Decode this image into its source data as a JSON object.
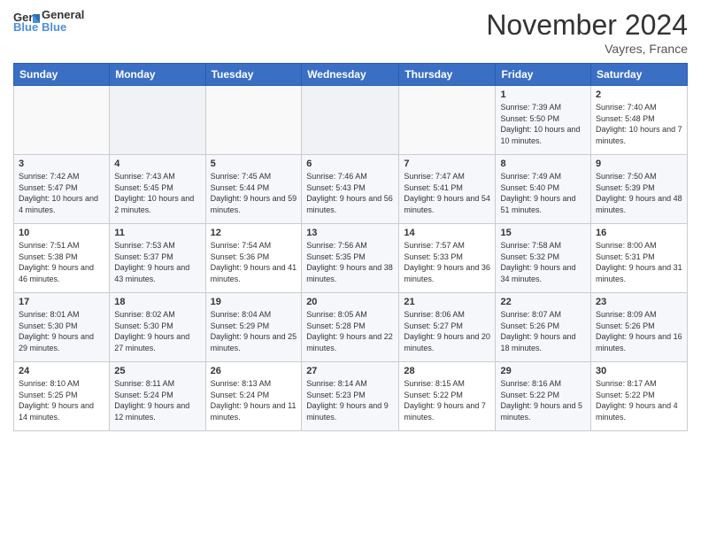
{
  "header": {
    "logo_text_general": "General",
    "logo_text_blue": "Blue",
    "month_title": "November 2024",
    "location": "Vayres, France"
  },
  "weekdays": [
    "Sunday",
    "Monday",
    "Tuesday",
    "Wednesday",
    "Thursday",
    "Friday",
    "Saturday"
  ],
  "weeks": [
    [
      {
        "day": "",
        "empty": true
      },
      {
        "day": "",
        "empty": true
      },
      {
        "day": "",
        "empty": true
      },
      {
        "day": "",
        "empty": true
      },
      {
        "day": "",
        "empty": true
      },
      {
        "day": "1",
        "sunrise": "Sunrise: 7:39 AM",
        "sunset": "Sunset: 5:50 PM",
        "daylight": "Daylight: 10 hours and 10 minutes."
      },
      {
        "day": "2",
        "sunrise": "Sunrise: 7:40 AM",
        "sunset": "Sunset: 5:48 PM",
        "daylight": "Daylight: 10 hours and 7 minutes."
      }
    ],
    [
      {
        "day": "3",
        "sunrise": "Sunrise: 7:42 AM",
        "sunset": "Sunset: 5:47 PM",
        "daylight": "Daylight: 10 hours and 4 minutes."
      },
      {
        "day": "4",
        "sunrise": "Sunrise: 7:43 AM",
        "sunset": "Sunset: 5:45 PM",
        "daylight": "Daylight: 10 hours and 2 minutes."
      },
      {
        "day": "5",
        "sunrise": "Sunrise: 7:45 AM",
        "sunset": "Sunset: 5:44 PM",
        "daylight": "Daylight: 9 hours and 59 minutes."
      },
      {
        "day": "6",
        "sunrise": "Sunrise: 7:46 AM",
        "sunset": "Sunset: 5:43 PM",
        "daylight": "Daylight: 9 hours and 56 minutes."
      },
      {
        "day": "7",
        "sunrise": "Sunrise: 7:47 AM",
        "sunset": "Sunset: 5:41 PM",
        "daylight": "Daylight: 9 hours and 54 minutes."
      },
      {
        "day": "8",
        "sunrise": "Sunrise: 7:49 AM",
        "sunset": "Sunset: 5:40 PM",
        "daylight": "Daylight: 9 hours and 51 minutes."
      },
      {
        "day": "9",
        "sunrise": "Sunrise: 7:50 AM",
        "sunset": "Sunset: 5:39 PM",
        "daylight": "Daylight: 9 hours and 48 minutes."
      }
    ],
    [
      {
        "day": "10",
        "sunrise": "Sunrise: 7:51 AM",
        "sunset": "Sunset: 5:38 PM",
        "daylight": "Daylight: 9 hours and 46 minutes."
      },
      {
        "day": "11",
        "sunrise": "Sunrise: 7:53 AM",
        "sunset": "Sunset: 5:37 PM",
        "daylight": "Daylight: 9 hours and 43 minutes."
      },
      {
        "day": "12",
        "sunrise": "Sunrise: 7:54 AM",
        "sunset": "Sunset: 5:36 PM",
        "daylight": "Daylight: 9 hours and 41 minutes."
      },
      {
        "day": "13",
        "sunrise": "Sunrise: 7:56 AM",
        "sunset": "Sunset: 5:35 PM",
        "daylight": "Daylight: 9 hours and 38 minutes."
      },
      {
        "day": "14",
        "sunrise": "Sunrise: 7:57 AM",
        "sunset": "Sunset: 5:33 PM",
        "daylight": "Daylight: 9 hours and 36 minutes."
      },
      {
        "day": "15",
        "sunrise": "Sunrise: 7:58 AM",
        "sunset": "Sunset: 5:32 PM",
        "daylight": "Daylight: 9 hours and 34 minutes."
      },
      {
        "day": "16",
        "sunrise": "Sunrise: 8:00 AM",
        "sunset": "Sunset: 5:31 PM",
        "daylight": "Daylight: 9 hours and 31 minutes."
      }
    ],
    [
      {
        "day": "17",
        "sunrise": "Sunrise: 8:01 AM",
        "sunset": "Sunset: 5:30 PM",
        "daylight": "Daylight: 9 hours and 29 minutes."
      },
      {
        "day": "18",
        "sunrise": "Sunrise: 8:02 AM",
        "sunset": "Sunset: 5:30 PM",
        "daylight": "Daylight: 9 hours and 27 minutes."
      },
      {
        "day": "19",
        "sunrise": "Sunrise: 8:04 AM",
        "sunset": "Sunset: 5:29 PM",
        "daylight": "Daylight: 9 hours and 25 minutes."
      },
      {
        "day": "20",
        "sunrise": "Sunrise: 8:05 AM",
        "sunset": "Sunset: 5:28 PM",
        "daylight": "Daylight: 9 hours and 22 minutes."
      },
      {
        "day": "21",
        "sunrise": "Sunrise: 8:06 AM",
        "sunset": "Sunset: 5:27 PM",
        "daylight": "Daylight: 9 hours and 20 minutes."
      },
      {
        "day": "22",
        "sunrise": "Sunrise: 8:07 AM",
        "sunset": "Sunset: 5:26 PM",
        "daylight": "Daylight: 9 hours and 18 minutes."
      },
      {
        "day": "23",
        "sunrise": "Sunrise: 8:09 AM",
        "sunset": "Sunset: 5:26 PM",
        "daylight": "Daylight: 9 hours and 16 minutes."
      }
    ],
    [
      {
        "day": "24",
        "sunrise": "Sunrise: 8:10 AM",
        "sunset": "Sunset: 5:25 PM",
        "daylight": "Daylight: 9 hours and 14 minutes."
      },
      {
        "day": "25",
        "sunrise": "Sunrise: 8:11 AM",
        "sunset": "Sunset: 5:24 PM",
        "daylight": "Daylight: 9 hours and 12 minutes."
      },
      {
        "day": "26",
        "sunrise": "Sunrise: 8:13 AM",
        "sunset": "Sunset: 5:24 PM",
        "daylight": "Daylight: 9 hours and 11 minutes."
      },
      {
        "day": "27",
        "sunrise": "Sunrise: 8:14 AM",
        "sunset": "Sunset: 5:23 PM",
        "daylight": "Daylight: 9 hours and 9 minutes."
      },
      {
        "day": "28",
        "sunrise": "Sunrise: 8:15 AM",
        "sunset": "Sunset: 5:22 PM",
        "daylight": "Daylight: 9 hours and 7 minutes."
      },
      {
        "day": "29",
        "sunrise": "Sunrise: 8:16 AM",
        "sunset": "Sunset: 5:22 PM",
        "daylight": "Daylight: 9 hours and 5 minutes."
      },
      {
        "day": "30",
        "sunrise": "Sunrise: 8:17 AM",
        "sunset": "Sunset: 5:22 PM",
        "daylight": "Daylight: 9 hours and 4 minutes."
      }
    ]
  ]
}
